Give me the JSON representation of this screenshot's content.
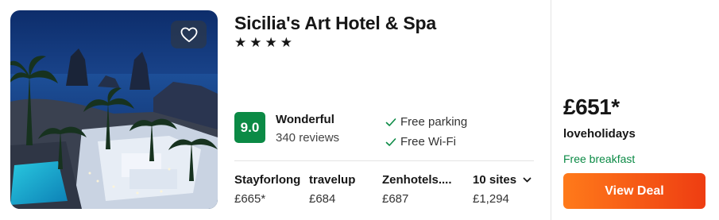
{
  "hotel": {
    "name": "Sicilia's Art Hotel & Spa",
    "stars": "★★★★",
    "star_count": 4
  },
  "rating": {
    "score": "9.0",
    "label": "Wonderful",
    "reviews": "340 reviews",
    "color": "#0b8a45"
  },
  "amenities": [
    {
      "label": "Free parking",
      "icon": "check-icon"
    },
    {
      "label": "Free Wi-Fi",
      "icon": "check-icon"
    }
  ],
  "sites": [
    {
      "name": "Stayforlong",
      "price": "£665*"
    },
    {
      "name": "travelup",
      "price": "£684"
    },
    {
      "name": "Zenhotels....",
      "price": "£687"
    },
    {
      "name": "10 sites",
      "price": "£1,294"
    }
  ],
  "deal": {
    "price": "£651*",
    "provider": "loveholidays",
    "perk": "Free breakfast",
    "button_label": "View Deal",
    "button_color": "#f25a16"
  },
  "image": {
    "favorite_icon": "heart-icon"
  }
}
